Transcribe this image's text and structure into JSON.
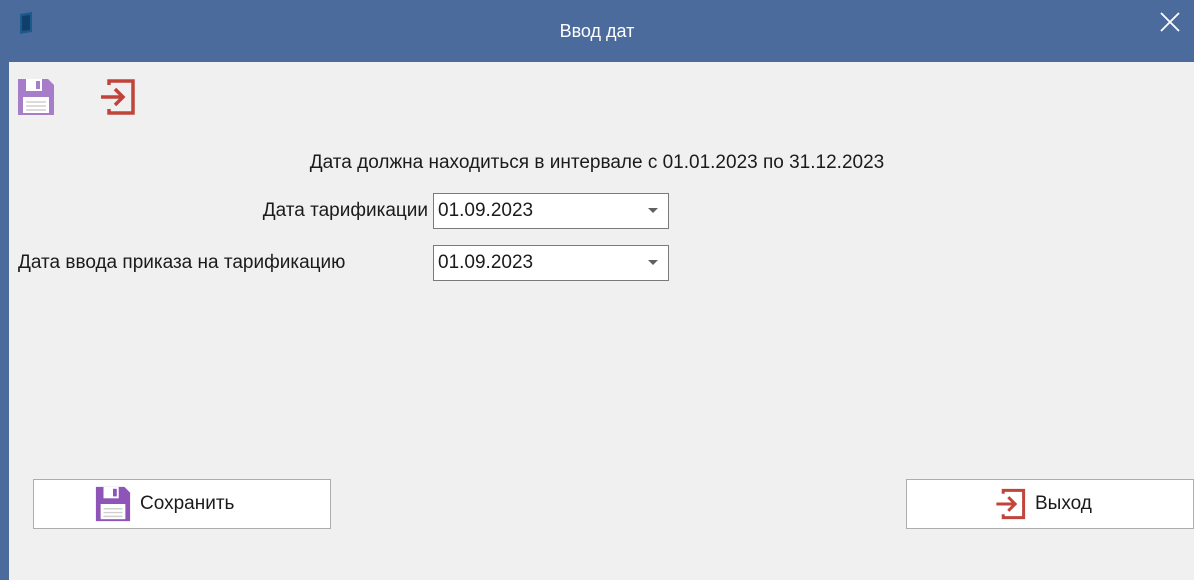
{
  "window": {
    "title": "Ввод дат",
    "colors": {
      "titlebar": "#4c6b9d",
      "background": "#f0f0f0"
    }
  },
  "toolbar": {
    "save_icon": "floppy-disk-icon",
    "exit_icon": "exit-arrow-icon"
  },
  "form": {
    "info_text": "Дата должна находиться в интервале с 01.01.2023 по 31.12.2023",
    "tarification_date": {
      "label": "Дата тарификации",
      "value": "01.09.2023"
    },
    "order_date": {
      "label": "Дата ввода приказа на тарификацию",
      "value": "01.09.2023"
    }
  },
  "buttons": {
    "save_label": "Сохранить",
    "exit_label": "Выход"
  },
  "icon_colors": {
    "save": "#9b6fbf",
    "exit": "#c0443a"
  }
}
